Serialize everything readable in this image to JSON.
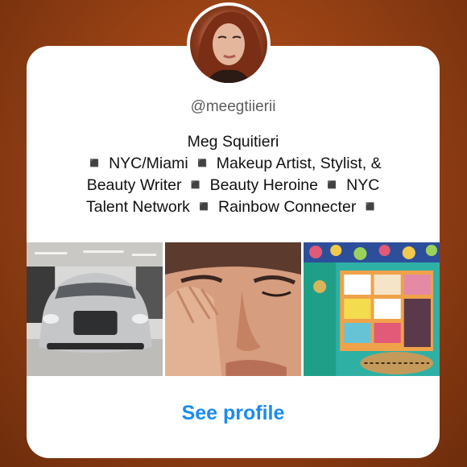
{
  "profile": {
    "handle": "@meegtiierii",
    "bio_name": "Meg Squitieri",
    "bio_line1": "◾ NYC/Miami ◾ Makeup Artist, Stylist, &",
    "bio_line2": "Beauty Writer ◾ Beauty Heroine ◾ NYC",
    "bio_line3": "Talent Network ◾ Rainbow Connecter ◾"
  },
  "posts": [
    {
      "icon": "car-photo"
    },
    {
      "icon": "face-photo"
    },
    {
      "icon": "closet-photo"
    }
  ],
  "actions": {
    "see_profile": "See profile"
  },
  "colors": {
    "accent": "#1a8cf0",
    "background": "#9a4215"
  }
}
